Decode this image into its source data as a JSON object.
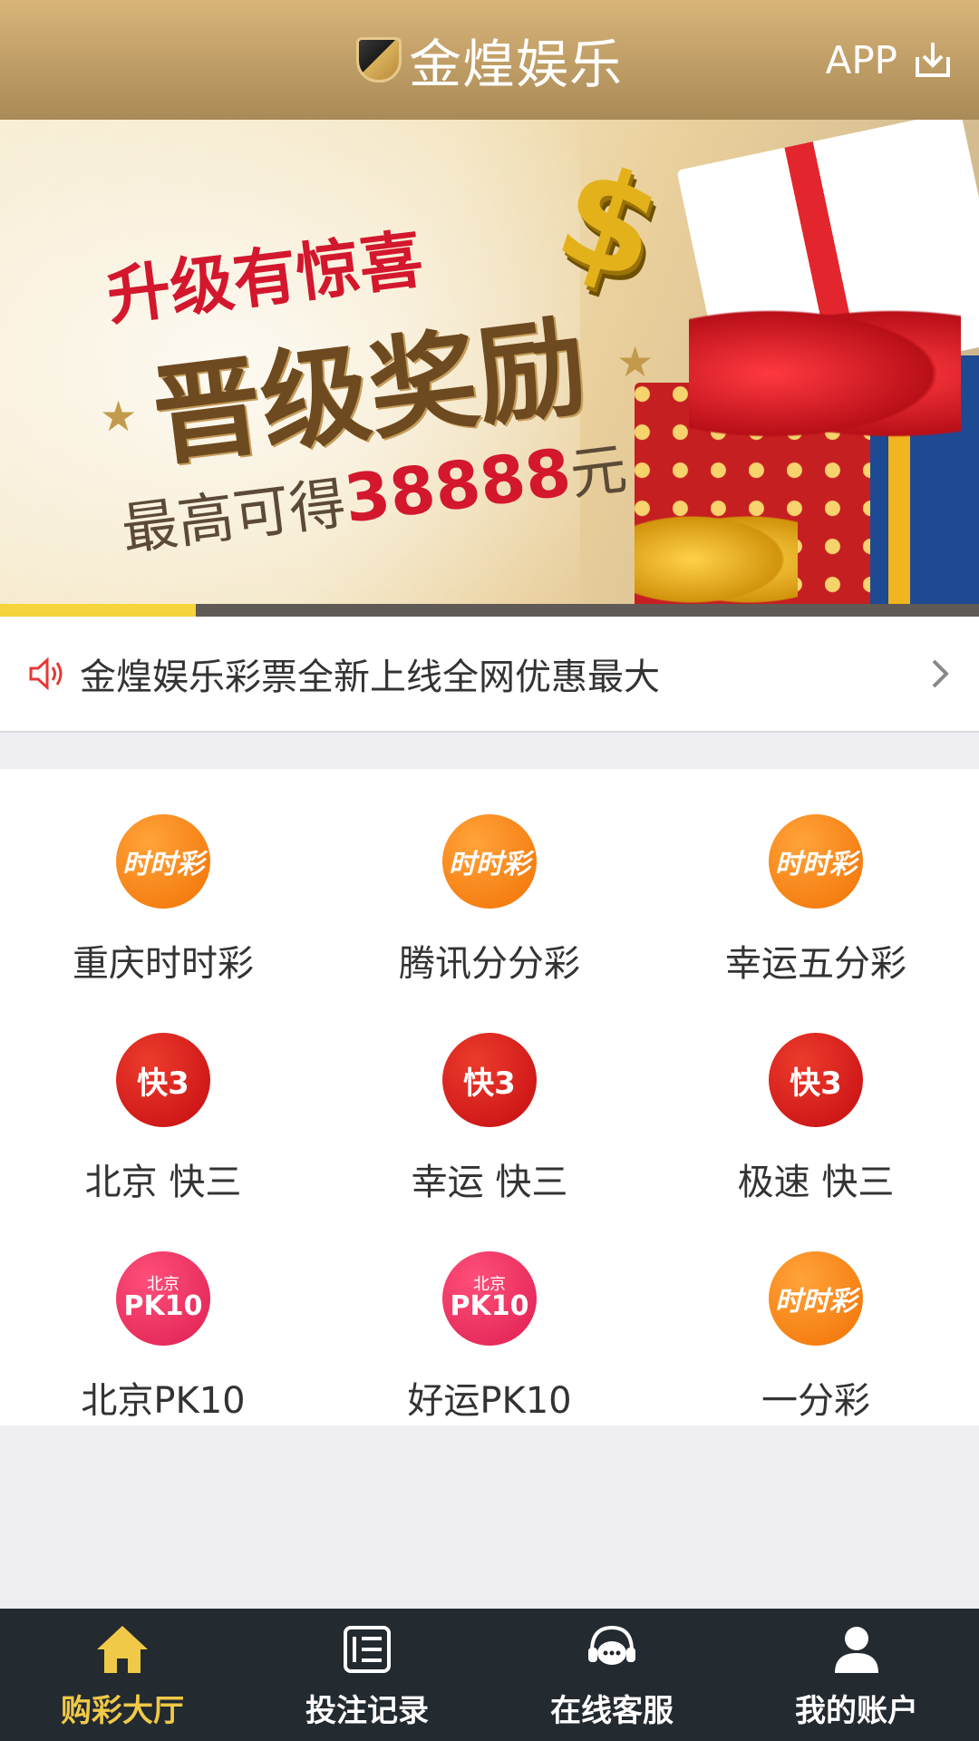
{
  "header": {
    "title": "金煌娱乐",
    "app_label": "APP"
  },
  "banner": {
    "line1": "升级有惊喜",
    "line2": "晋级奖励",
    "line3_prefix": "最高可得",
    "line3_amount": "38888",
    "line3_unit": "元",
    "carousel_progress_percent": 20
  },
  "notice": {
    "text": "金煌娱乐彩票全新上线全网优惠最大"
  },
  "games": [
    {
      "name": "重庆时时彩",
      "icon": "shishicai-icon",
      "icon_text": "时时彩"
    },
    {
      "name": "腾讯分分彩",
      "icon": "shishicai-icon",
      "icon_text": "时时彩"
    },
    {
      "name": "幸运五分彩",
      "icon": "shishicai-icon",
      "icon_text": "时时彩"
    },
    {
      "name": "北京 快三",
      "icon": "kuaisan-icon",
      "icon_text": "快3"
    },
    {
      "name": "幸运 快三",
      "icon": "kuaisan-icon",
      "icon_text": "快3"
    },
    {
      "name": "极速 快三",
      "icon": "kuaisan-icon",
      "icon_text": "快3"
    },
    {
      "name": "北京PK10",
      "icon": "pk10-icon",
      "icon_text": "PK10",
      "icon_sub": "北京"
    },
    {
      "name": "好运PK10",
      "icon": "pk10-icon",
      "icon_text": "PK10",
      "icon_sub": "北京"
    },
    {
      "name": "一分彩",
      "icon": "shishicai-icon",
      "icon_text": "时时彩"
    }
  ],
  "tabbar": {
    "items": [
      {
        "label": "购彩大厅",
        "icon": "home-icon",
        "active": true
      },
      {
        "label": "投注记录",
        "icon": "records-icon",
        "active": false
      },
      {
        "label": "在线客服",
        "icon": "customer-service-icon",
        "active": false
      },
      {
        "label": "我的账户",
        "icon": "user-icon",
        "active": false
      }
    ]
  },
  "colors": {
    "header_gold": "#c8a36a",
    "active_tab": "#f0c948",
    "tabbar_bg": "#232a30",
    "accent_red": "#d3172d"
  }
}
